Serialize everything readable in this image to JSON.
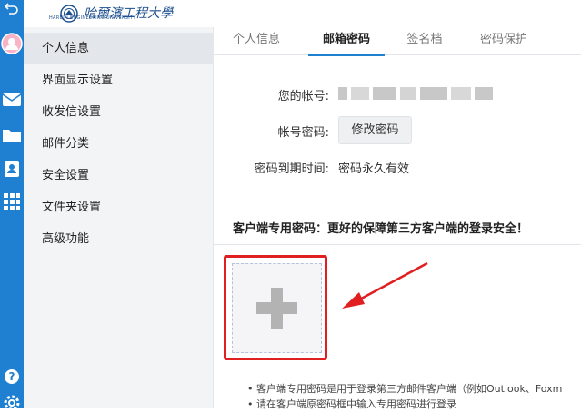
{
  "colors": {
    "accent": "#1f7fd1",
    "annotation": "#e02020"
  },
  "rail": {
    "icons": [
      "back-arrow-icon",
      "avatar",
      "mail-icon",
      "folder-icon",
      "contacts-icon",
      "apps-grid-icon",
      "help-icon",
      "settings-icon"
    ]
  },
  "logo": {
    "name": "哈爾濱工程大學",
    "sub": "HARBIN ENGINEERING UNIVERSITY"
  },
  "sidebar": {
    "items": [
      {
        "label": "个人信息",
        "active": true
      },
      {
        "label": "界面显示设置"
      },
      {
        "label": "收发信设置"
      },
      {
        "label": "邮件分类"
      },
      {
        "label": "安全设置"
      },
      {
        "label": "文件夹设置"
      },
      {
        "label": "高级功能"
      }
    ]
  },
  "tabs": [
    {
      "label": "个人信息"
    },
    {
      "label": "邮箱密码",
      "active": true
    },
    {
      "label": "签名档"
    },
    {
      "label": "密码保护"
    }
  ],
  "account": {
    "account_label": "您的帐号:",
    "password_label": "帐号密码:",
    "change_password_button": "修改密码",
    "expiry_label": "密码到期时间:",
    "expiry_value": "密码永久有效"
  },
  "client_password": {
    "title": "客户端专用密码：更好的保障第三方客户端的登录安全！",
    "add_symbol": "+",
    "notes": [
      "客户端专用密码是用于登录第三方邮件客户端（例如Outlook、Foxm",
      "请在客户端原密码框中输入专用密码进行登录"
    ]
  }
}
